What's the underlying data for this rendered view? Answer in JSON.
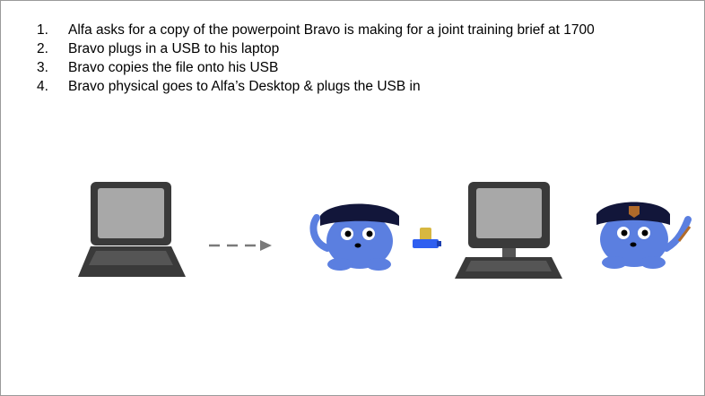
{
  "steps": [
    {
      "number": "1.",
      "text": "Alfa asks for a copy of the powerpoint Bravo is making for a joint training brief at 1700"
    },
    {
      "number": "2.",
      "text": "Bravo plugs in a USB to his laptop"
    },
    {
      "number": "3.",
      "text": "Bravo copies the file onto his USB"
    },
    {
      "number": "4.",
      "text": "Bravo physical goes to Alfa’s Desktop & plugs the USB in"
    }
  ],
  "colors": {
    "creature": "#5b7fe0",
    "usb_body": "#2f5ff0",
    "usb_plug": "#d7b740",
    "device_dark": "#3a3a3a",
    "screen_gray": "#a8a8a8",
    "hat": "#12163a",
    "badge": "#b06a2a",
    "arrow": "#7a7a7a"
  },
  "icons": [
    "laptop-icon",
    "arrow-icon",
    "bravo-creature-icon",
    "usb-drive-icon",
    "desktop-computer-icon",
    "alfa-creature-icon"
  ]
}
